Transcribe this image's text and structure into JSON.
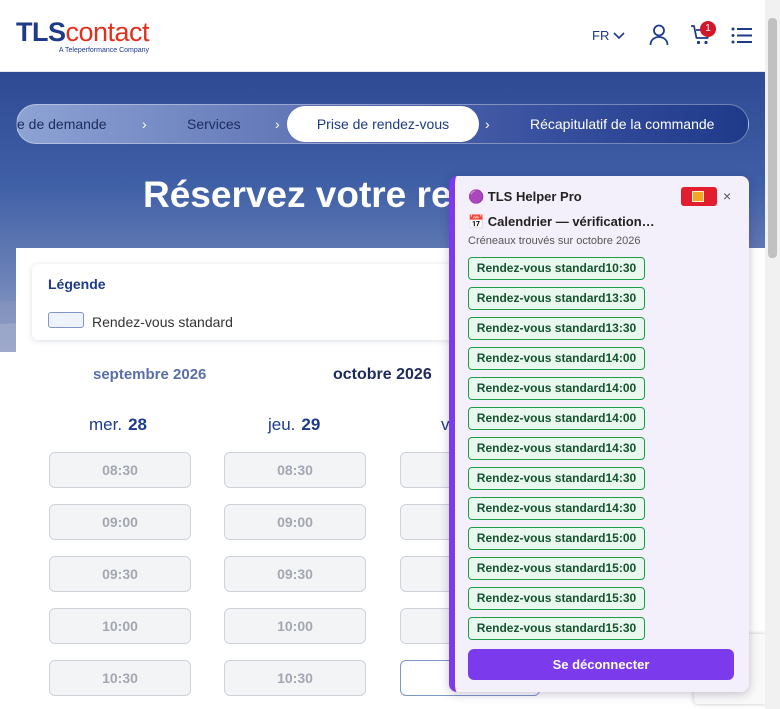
{
  "header": {
    "logo_main_1": "TLS",
    "logo_main_2": "contact",
    "logo_sub": "A Teleperformance Company",
    "lang": "FR",
    "cart_count": "1"
  },
  "steps": {
    "items": [
      "e de demande",
      "Services",
      "Prise de rendez-vous",
      "Récapitulatif de la commande"
    ],
    "separator": "›"
  },
  "hero": {
    "title": "Réservez votre ren"
  },
  "legend": {
    "title": "Légende",
    "standard_label": "Rendez-vous standard"
  },
  "calendar": {
    "months": [
      "septembre 2026",
      "octobre 2026"
    ],
    "days": [
      {
        "name": "mer.",
        "num": "28"
      },
      {
        "name": "jeu.",
        "num": "29"
      },
      {
        "name": "v",
        "num": ""
      }
    ],
    "times": [
      "08:30",
      "09:00",
      "09:30",
      "10:00",
      "10:30"
    ]
  },
  "helper": {
    "title": "🟣 TLS Helper Pro",
    "close": "×",
    "subtitle": "📅 Calendrier — vérification…",
    "note": "Créneaux trouvés sur octobre 2026",
    "slots": [
      "Rendez-vous standard10:30",
      "Rendez-vous standard13:30",
      "Rendez-vous standard13:30",
      "Rendez-vous standard14:00",
      "Rendez-vous standard14:00",
      "Rendez-vous standard14:00",
      "Rendez-vous standard14:30",
      "Rendez-vous standard14:30",
      "Rendez-vous standard14:30",
      "Rendez-vous standard15:00",
      "Rendez-vous standard15:00",
      "Rendez-vous standard15:30",
      "Rendez-vous standard15:30"
    ],
    "logout": "Se déconnecter"
  },
  "colors": {
    "brand_blue": "#1e3a8a",
    "brand_red": "#e0301e",
    "helper_purple": "#7c3aed",
    "slot_green": "#1f9d46"
  }
}
